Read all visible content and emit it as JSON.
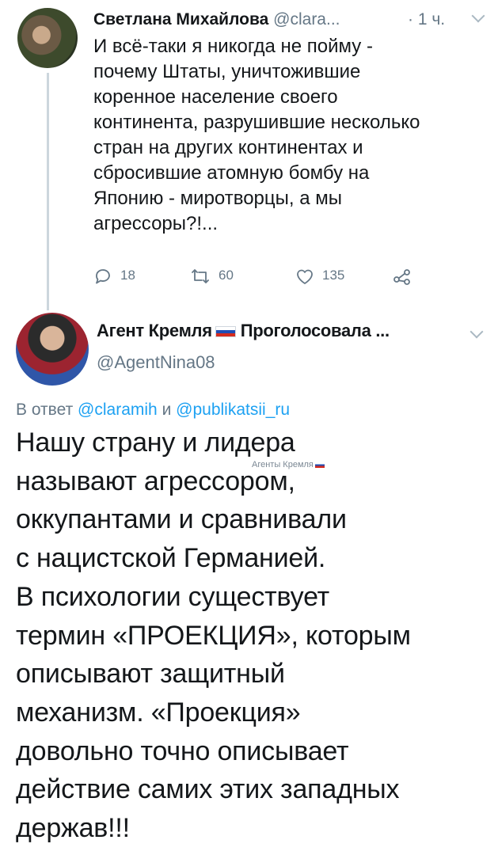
{
  "tweet1": {
    "name": "Светлана Михайлова",
    "handle": "@clara...",
    "time": "· 1 ч.",
    "text": "И всё-таки я никогда не пойму -\nпочему Штаты, уничтожившие\nкоренное население своего\nконтинента, разрушившие несколько\nстран на других континентах и\nсбросившие атомную бомбу на\nЯпонию - миротворцы, а мы\nагрессоры?!...",
    "replies": "18",
    "retweets": "60",
    "likes": "135",
    "icons": [
      "reply-icon",
      "retweet-icon",
      "like-icon",
      "share-icon",
      "chevron-down-icon"
    ]
  },
  "tweet2": {
    "name": "Агент Кремля",
    "name_suffix": "Проголосовала ...",
    "handle": "@AgentNina08",
    "reply_prefix": "В ответ",
    "mention1": "@claramih",
    "reply_and": "и",
    "mention2": "@publikatsii_ru",
    "text": "Нашу страну и лидера\nназывают агрессором,\nоккупантами и сравнивали\nс нацистской Германией.\nВ психологии существует\nтермин «ПРОЕКЦИЯ», которым\nописывают защитный\nмеханизм. «Проекция»\nдовольно точно описывает\nдействие самих этих западных\nдержав!!!",
    "watermark": "Агенты Кремля"
  },
  "colors": {
    "text": "#14171a",
    "secondary": "#657786",
    "link": "#1da1f2",
    "thread_line": "#ccd6dd"
  }
}
